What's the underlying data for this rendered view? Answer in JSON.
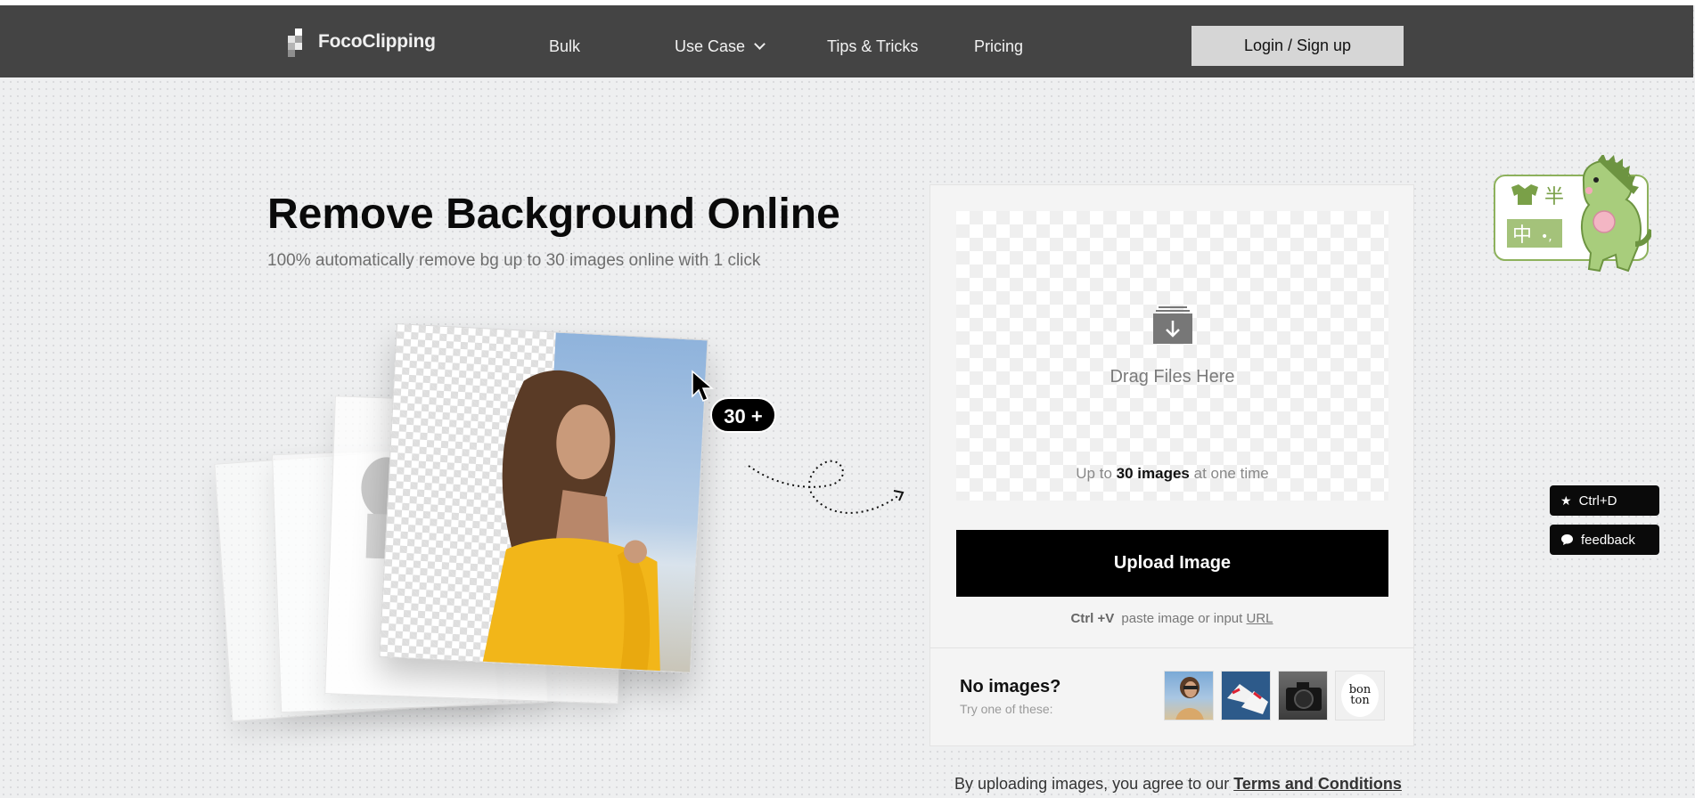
{
  "nav": {
    "logo_text": "FocoClipping",
    "items": [
      {
        "label": "Bulk"
      },
      {
        "label": "Use Case"
      },
      {
        "label": "Tips & Tricks"
      },
      {
        "label": "Pricing"
      }
    ],
    "login_label": "Login / Sign up"
  },
  "hero": {
    "title": "Remove Background Online",
    "subtitle": "100% automatically remove bg up to 30 images online with 1 click",
    "badge": "30 +"
  },
  "upload": {
    "drop_text": "Drag Files Here",
    "limit_prefix": "Up to",
    "limit_bold": "30 images",
    "limit_suffix": "at one time",
    "button_label": "Upload Image",
    "paste_shortcut": "Ctrl +V",
    "paste_text": "paste image or input",
    "paste_link": "URL"
  },
  "samples": {
    "title": "No images?",
    "subtitle": "Try one of these:",
    "thumb4_text": "bon ton"
  },
  "terms": {
    "text": "By uploading images, you agree to our",
    "link": "Terms and Conditions"
  },
  "side": {
    "bookmark_label": "Ctrl+D",
    "feedback_label": "feedback"
  },
  "mascot": {
    "chars": [
      "半",
      "中"
    ],
    "small_text": "•,"
  },
  "colors": {
    "navbar": "#444444",
    "accent": "#000000",
    "mascot_green": "#8db15c"
  }
}
